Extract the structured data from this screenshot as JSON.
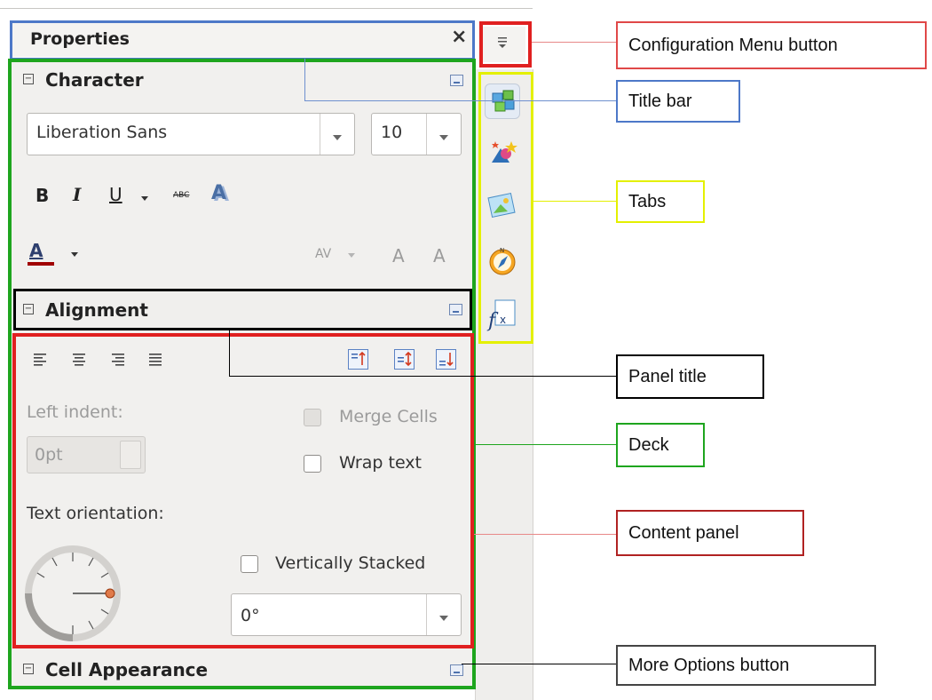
{
  "sidebar": {
    "title": "Properties",
    "close_glyph": "×",
    "menu_glyph": "≡",
    "character": {
      "title": "Character",
      "font_name": "Liberation Sans",
      "font_size": "10",
      "bold": "B",
      "italic": "I",
      "underline": "U",
      "strike": "ABC",
      "shadow": "A",
      "font_color_glyph": "A",
      "spacing_glyph": "AV",
      "grow_glyph": "A",
      "shrink_glyph": "A"
    },
    "alignment": {
      "title": "Alignment",
      "left_indent_label": "Left indent:",
      "left_indent_value": "0pt",
      "merge_cells_label": "Merge Cells",
      "wrap_text_label": "Wrap text",
      "text_orientation_label": "Text orientation:",
      "vertically_stacked_label": "Vertically Stacked",
      "rotation_value": "0°"
    },
    "cell_appearance": {
      "title": "Cell Appearance"
    },
    "tabs": [
      "properties-icon",
      "styles-icon",
      "gallery-icon",
      "navigator-icon",
      "functions-icon"
    ]
  },
  "callouts": {
    "config_menu": "Configuration Menu button",
    "title_bar": "Title bar",
    "tabs": "Tabs",
    "panel_title": "Panel title",
    "deck": "Deck",
    "content_panel": "Content panel",
    "more_options": "More Options button"
  },
  "colors": {
    "red": "#e02020",
    "blue": "#4d78c8",
    "green": "#1ea51e",
    "yellow": "#e4f000",
    "black": "#000000"
  }
}
